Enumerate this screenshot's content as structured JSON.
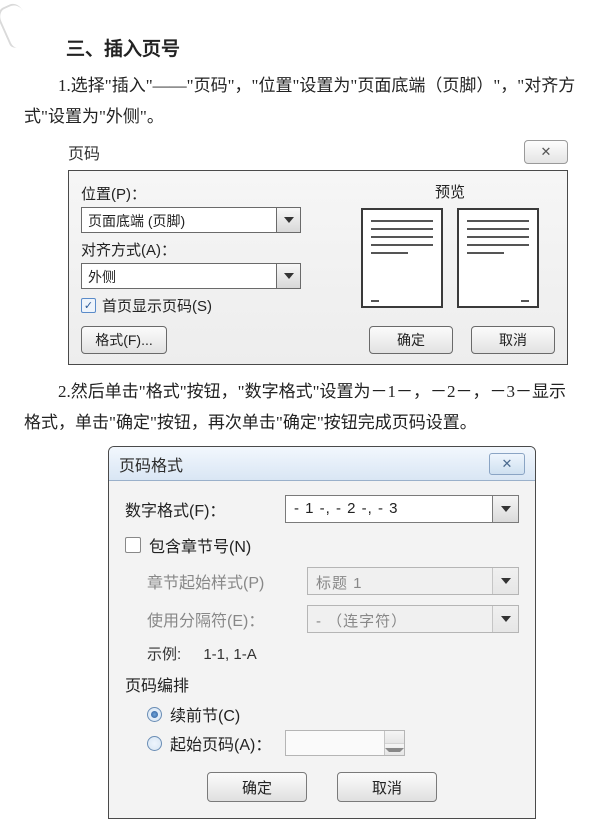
{
  "heading": "三、插入页号",
  "para1": "1.选择\"插入\"——\"页码\"，\"位置\"设置为\"页面底端（页脚）\"，\"对齐方式\"设置为\"外侧\"。",
  "para2": "2.然后单击\"格式\"按钮，\"数字格式\"设置为－1－，－2－，－3－显示格式，单击\"确定\"按钮，再次单击\"确定\"按钮完成页码设置。",
  "dlg1": {
    "title": "页码",
    "close": "✕",
    "position_label": "位置(P)：",
    "position_value": "页面底端 (页脚)",
    "align_label": "对齐方式(A)：",
    "align_value": "外侧",
    "firstpage_label": "首页显示页码(S)",
    "preview_label": "预览",
    "format_btn": "格式(F)...",
    "ok": "确定",
    "cancel": "取消"
  },
  "dlg2": {
    "title": "页码格式",
    "close": "✕",
    "numfmt_label": "数字格式(F)：",
    "numfmt_value": "- 1 -, - 2 -, - 3",
    "include_chapter": "包含章节号(N)",
    "chapter_style_label": "章节起始样式(P)",
    "chapter_style_value": "标题 1",
    "separator_label": "使用分隔符(E)：",
    "separator_value": "-  （连字符）",
    "example_label": "示例:",
    "example_value": "1-1,  1-A",
    "group_title": "页码编排",
    "radio_continue": "续前节(C)",
    "radio_startat": "起始页码(A)：",
    "ok": "确定",
    "cancel": "取消"
  }
}
